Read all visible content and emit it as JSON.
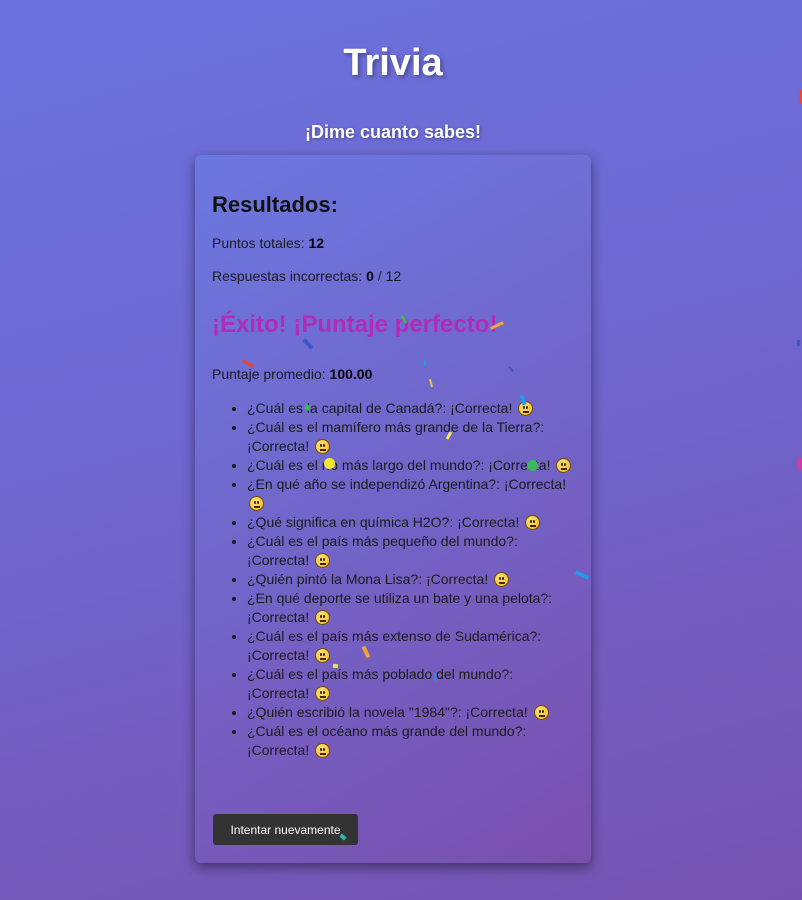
{
  "header": {
    "title": "Trivia",
    "subtitle": "¡Dime cuanto sabes!"
  },
  "results": {
    "heading": "Resultados:",
    "total_points_label": "Puntos totales: ",
    "total_points_value": "12",
    "incorrect_label": "Respuestas incorrectas: ",
    "incorrect_value": "0",
    "incorrect_total": " / 12",
    "success_message": "¡Éxito! ¡Puntaje perfecto!",
    "average_label": "Puntaje promedio: ",
    "average_value": "100.00"
  },
  "answers": [
    {
      "text": "¿Cuál es la capital de Canadá?: ¡Correcta!"
    },
    {
      "text": "¿Cuál es el mamífero más grande de la Tierra?: ¡Correcta!"
    },
    {
      "text": "¿Cuál es el río más largo del mundo?: ¡Correcta!"
    },
    {
      "text": "¿En qué año se independizó Argentina?: ¡Correcta!"
    },
    {
      "text": "¿Qué significa en química H2O?: ¡Correcta!"
    },
    {
      "text": "¿Cuál es el país más pequeño del mundo?: ¡Correcta!"
    },
    {
      "text": "¿Quién pintó la Mona Lisa?: ¡Correcta!"
    },
    {
      "text": "¿En qué deporte se utiliza un bate y una pelota?: ¡Correcta!"
    },
    {
      "text": "¿Cuál es el país más extenso de Sudamérica?: ¡Correcta!"
    },
    {
      "text": "¿Cuál es el país más poblado del mundo?: ¡Correcta!"
    },
    {
      "text": "¿Quién escribió la novela \"1984\"?: ¡Correcta!"
    },
    {
      "text": "¿Cuál es el océano más grande del mundo?: ¡Correcta!"
    }
  ],
  "answer_icon": "neutral-face-emoji",
  "actions": {
    "retry_label": "Intentar nuevamente"
  },
  "colors": {
    "success": "#b22bb5",
    "button_bg": "#333333"
  }
}
